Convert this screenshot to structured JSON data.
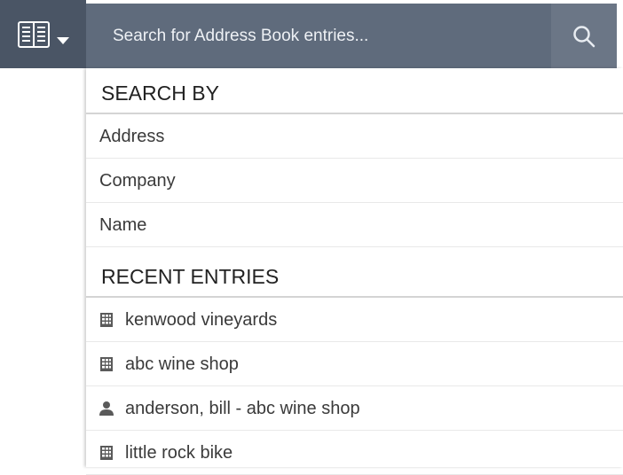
{
  "toolbar": {
    "address_book_icon": "address-book-icon",
    "dropdown_caret_icon": "caret-down-icon"
  },
  "search": {
    "placeholder": "Search for Address Book entries...",
    "value": "",
    "button_icon": "search-icon"
  },
  "dropdown": {
    "search_by": {
      "title": "SEARCH BY",
      "items": [
        {
          "label": "Address"
        },
        {
          "label": "Company"
        },
        {
          "label": "Name"
        }
      ]
    },
    "recent_entries": {
      "title": "RECENT ENTRIES",
      "items": [
        {
          "label": "kenwood vineyards",
          "icon": "building-icon"
        },
        {
          "label": "abc wine shop",
          "icon": "building-icon"
        },
        {
          "label": "anderson, bill - abc wine shop",
          "icon": "person-icon"
        },
        {
          "label": "little rock bike",
          "icon": "building-icon"
        }
      ]
    }
  },
  "colors": {
    "toolbar_bg": "#4a5565",
    "search_bg": "#5f6b7c",
    "search_button_bg": "#6b7686",
    "text": "#3a3a3a"
  }
}
